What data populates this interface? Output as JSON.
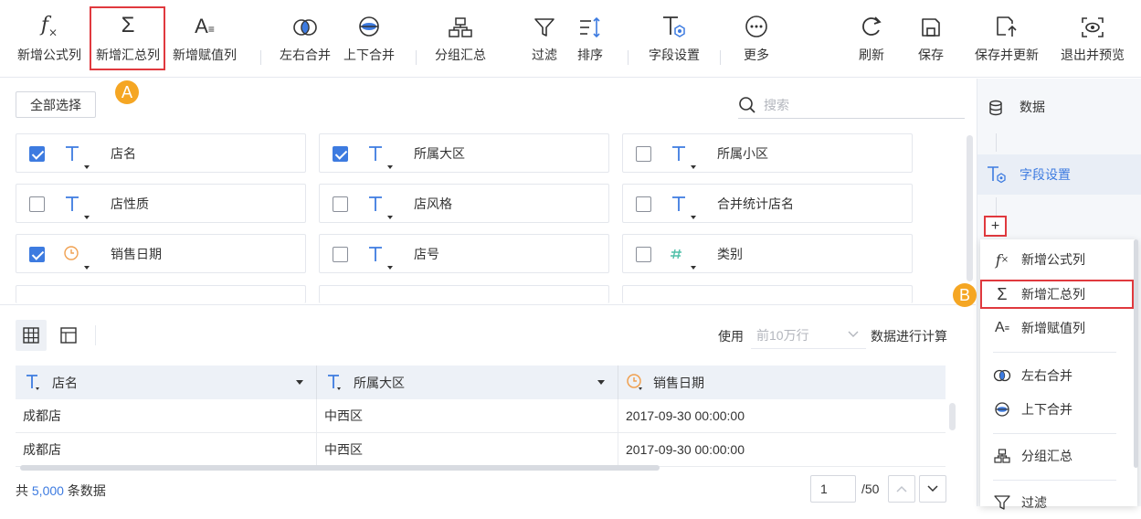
{
  "toolbar": {
    "items": [
      {
        "label": "新增公式列",
        "icon": "fx-icon"
      },
      {
        "label": "新增汇总列",
        "icon": "sigma-icon"
      },
      {
        "label": "新增赋值列",
        "icon": "assign-icon"
      },
      {
        "label": "左右合并",
        "icon": "merge-horizontal-icon"
      },
      {
        "label": "上下合并",
        "icon": "merge-vertical-icon"
      },
      {
        "label": "分组汇总",
        "icon": "group-summary-icon"
      },
      {
        "label": "过滤",
        "icon": "filter-icon"
      },
      {
        "label": "排序",
        "icon": "sort-icon"
      },
      {
        "label": "字段设置",
        "icon": "field-settings-icon"
      },
      {
        "label": "更多",
        "icon": "more-icon"
      },
      {
        "label": "刷新",
        "icon": "refresh-icon"
      },
      {
        "label": "保存",
        "icon": "save-icon"
      },
      {
        "label": "保存并更新",
        "icon": "save-update-icon"
      },
      {
        "label": "退出并预览",
        "icon": "exit-preview-icon"
      }
    ]
  },
  "annotations": {
    "a": "A",
    "b": "B"
  },
  "fields": {
    "select_all_label": "全部选择",
    "search_placeholder": "搜索",
    "items": [
      {
        "name": "店名",
        "type": "text",
        "checked": true
      },
      {
        "name": "所属大区",
        "type": "text",
        "checked": true
      },
      {
        "name": "所属小区",
        "type": "text",
        "checked": false
      },
      {
        "name": "店性质",
        "type": "text",
        "checked": false
      },
      {
        "name": "店风格",
        "type": "text",
        "checked": false
      },
      {
        "name": "合并统计店名",
        "type": "text",
        "checked": false
      },
      {
        "name": "销售日期",
        "type": "date",
        "checked": true
      },
      {
        "name": "店号",
        "type": "text",
        "checked": false
      },
      {
        "name": "类别",
        "type": "number",
        "checked": false
      }
    ]
  },
  "preview": {
    "use_label": "使用",
    "rows_option": "前10万行",
    "compute_label": "数据进行计算",
    "columns": [
      {
        "name": "店名",
        "type": "text"
      },
      {
        "name": "所属大区",
        "type": "text"
      },
      {
        "name": "销售日期",
        "type": "date"
      }
    ],
    "rows": [
      [
        "成都店",
        "中西区",
        "2017-09-30 00:00:00"
      ],
      [
        "成都店",
        "中西区",
        "2017-09-30 00:00:00"
      ]
    ],
    "footer_prefix": "共",
    "total_count": "5,000",
    "footer_suffix": "条数据",
    "page_current": "1",
    "page_total": "/50"
  },
  "right_panel": {
    "data_label": "数据",
    "field_settings_label": "字段设置",
    "plus_label": "+",
    "menu": [
      {
        "label": "新增公式列",
        "icon": "fx-icon"
      },
      {
        "label": "新增汇总列",
        "icon": "sigma-icon"
      },
      {
        "label": "新增赋值列",
        "icon": "assign-icon"
      },
      {
        "label": "左右合并",
        "icon": "merge-horizontal-icon"
      },
      {
        "label": "上下合并",
        "icon": "merge-vertical-icon"
      },
      {
        "label": "分组汇总",
        "icon": "group-summary-icon"
      },
      {
        "label": "过滤",
        "icon": "filter-icon"
      }
    ]
  },
  "colors": {
    "accent": "#3d7be0",
    "highlight": "#e0393e",
    "badge": "#f5a623",
    "date_icon": "#f0a050",
    "number_icon": "#4fbfa8"
  }
}
